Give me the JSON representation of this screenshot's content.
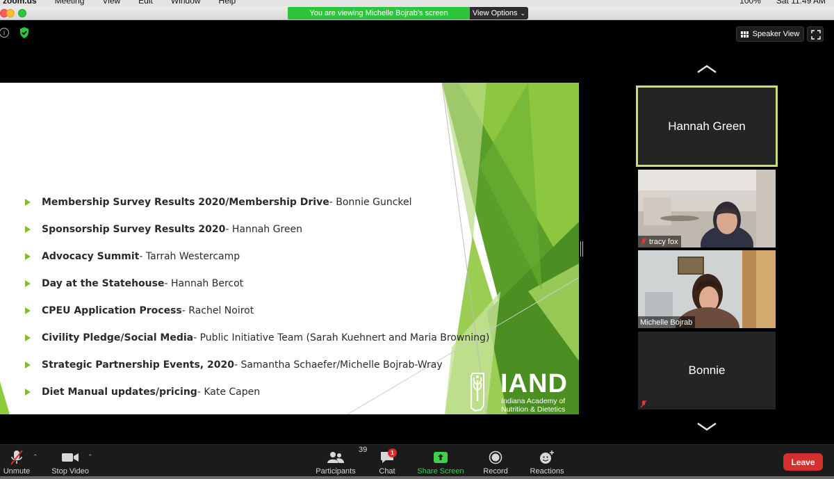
{
  "menubar": {
    "app": "zoom.us",
    "items": [
      "Meeting",
      "View",
      "Edit",
      "Window",
      "Help"
    ],
    "battery": "100%",
    "clock": "Sat 11:49 AM"
  },
  "banner": {
    "viewing_text": "You are viewing Michelle Bojrab's screen",
    "view_options_label": "View Options"
  },
  "top_controls": {
    "speaker_view_label": "Speaker View"
  },
  "slide": {
    "agenda": [
      {
        "topic": "Membership Survey Results 2020/Membership Drive",
        "presenter": " - Bonnie Gunckel"
      },
      {
        "topic": "Sponsorship Survey Results 2020",
        "presenter": " - Hannah Green"
      },
      {
        "topic": "Advocacy Summit",
        "presenter": " - Tarrah Westercamp"
      },
      {
        "topic": "Day at the Statehouse",
        "presenter": " - Hannah Bercot"
      },
      {
        "topic": "CPEU Application Process",
        "presenter": " - Rachel Noirot"
      },
      {
        "topic": "Civility Pledge/Social Media",
        "presenter": " - Public Initiative Team  (Sarah Kuehnert and Maria Browning)"
      },
      {
        "topic": "Strategic Partnership Events, 2020",
        "presenter": " - Samantha Schaefer/Michelle Bojrab-Wray"
      },
      {
        "topic": "Diet Manual updates/pricing",
        "presenter": " - Kate Capen"
      }
    ],
    "logo": {
      "name": "IAND",
      "line1": "Indiana Academy of",
      "line2": "Nutrition & Dietetics"
    }
  },
  "gallery": {
    "tiles": [
      {
        "name": "Hannah Green",
        "active": true
      },
      {
        "name": "tracy fox",
        "muted": true
      },
      {
        "name": "Michelle Bojrab",
        "muted": false
      },
      {
        "name": "Bonnie",
        "muted": true
      }
    ]
  },
  "toolbar": {
    "unmute_label": "Unmute",
    "stop_video_label": "Stop Video",
    "participants_label": "Participants",
    "participants_count": "39",
    "chat_label": "Chat",
    "chat_badge": "1",
    "share_screen_label": "Share Screen",
    "record_label": "Record",
    "reactions_label": "Reactions",
    "leave_label": "Leave"
  },
  "colors": {
    "banner_green": "#2ec43b",
    "slide_green": "#7fbf2e",
    "active_border": "#c6e26a",
    "leave_red": "#d5302f"
  }
}
